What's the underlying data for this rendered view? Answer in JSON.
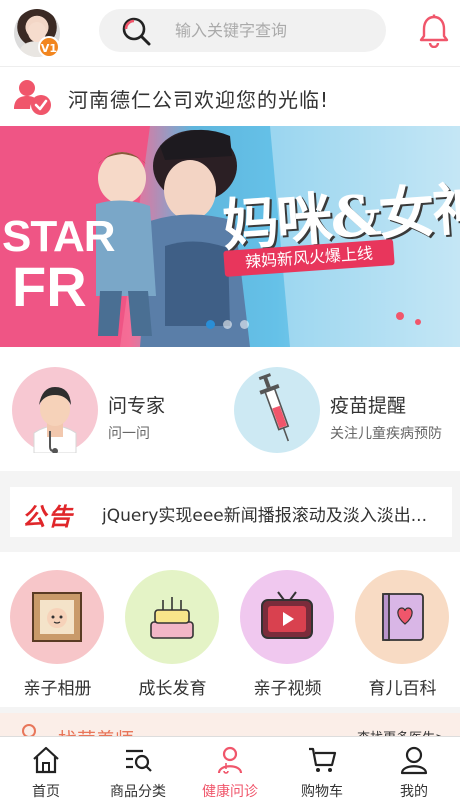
{
  "header": {
    "vip_badge": "V1",
    "search_placeholder": "输入关键字查询"
  },
  "welcome": {
    "text": "河南德仁公司欢迎您的光临!"
  },
  "banner": {
    "title": "妈咪&女神",
    "subtitle": "辣妈新风火爆上线",
    "left_text_1": "STAR",
    "left_text_2": "FR",
    "slide_count": 3,
    "active_slide": 1
  },
  "services": [
    {
      "title": "问专家",
      "subtitle": "问一问",
      "icon": "doctor-icon"
    },
    {
      "title": "疫苗提醒",
      "subtitle": "关注儿童疾病预防",
      "icon": "syringe-icon"
    }
  ],
  "notice": {
    "tag": "公告",
    "text": "jQuery实现eee新闻播报滚动及淡入淡出..."
  },
  "categories": [
    {
      "label": "亲子相册",
      "icon": "photo-frame-icon",
      "color": "#f7c6c9"
    },
    {
      "label": "成长发育",
      "icon": "cake-icon",
      "color": "#e4f3c6"
    },
    {
      "label": "亲子视频",
      "icon": "tv-icon",
      "color": "#f0c8ef"
    },
    {
      "label": "育儿百科",
      "icon": "book-icon",
      "color": "#f8dbc4"
    }
  ],
  "teacher": {
    "title": "找营养师",
    "more": "查找更多医生>"
  },
  "tabbar": [
    {
      "label": "首页",
      "icon": "home-icon",
      "active": false
    },
    {
      "label": "商品分类",
      "icon": "category-search-icon",
      "active": false
    },
    {
      "label": "健康问诊",
      "icon": "health-consult-icon",
      "active": true
    },
    {
      "label": "购物车",
      "icon": "cart-icon",
      "active": false
    },
    {
      "label": "我的",
      "icon": "user-icon",
      "active": false
    }
  ],
  "colors": {
    "accent": "#f0566b",
    "notice_red": "#e0262a",
    "teacher_orange": "#e8765a"
  }
}
